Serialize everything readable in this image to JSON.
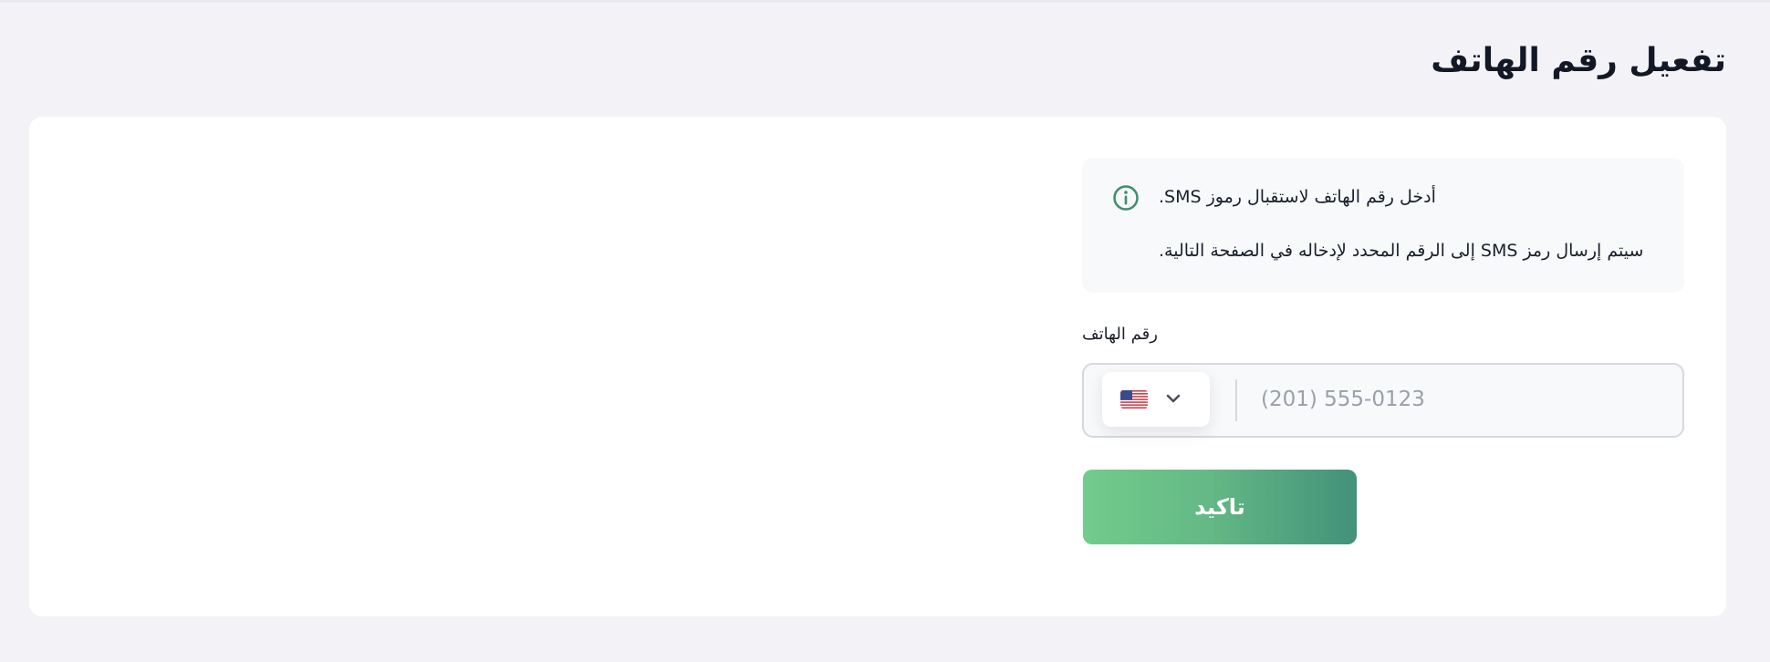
{
  "page": {
    "title": "تفعيل رقم الهاتف"
  },
  "info": {
    "icon": "info-icon",
    "line1": "أدخل رقم الهاتف لاستقبال رموز SMS.",
    "line2": "سيتم إرسال رمز SMS إلى الرقم المحدد لإدخاله في الصفحة التالية."
  },
  "phone": {
    "label": "رقم الهاتف",
    "placeholder": "(201) 555-0123",
    "value": "",
    "country_flag": "us-flag-icon",
    "dropdown_icon": "chevron-down-icon"
  },
  "actions": {
    "confirm_label": "تاكيد"
  },
  "colors": {
    "background": "#f3f3f7",
    "card": "#ffffff",
    "info_box": "#f8f9fb",
    "icon_green": "#3d8f6b",
    "button_gradient_start": "#72cc8c",
    "button_gradient_end": "#43917a",
    "title_text": "#121826"
  }
}
